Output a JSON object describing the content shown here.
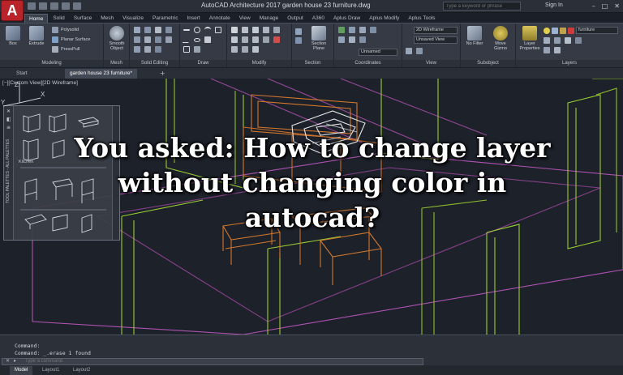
{
  "title_bar": {
    "app_logo": "A",
    "window_title": "AutoCAD Architecture 2017    garden house 23 furniture.dwg",
    "search_placeholder": "Type a keyword or phrase",
    "sign_in": "Sign In"
  },
  "ribbon_tabs": [
    "Home",
    "Solid",
    "Surface",
    "Mesh",
    "Visualize",
    "Parametric",
    "Insert",
    "Annotate",
    "View",
    "Manage",
    "Output",
    "A360",
    "Aplus Draw",
    "Aplus Modify",
    "Aplus Tools"
  ],
  "ribbon": {
    "modeling": {
      "label": "Modeling",
      "box": "Box",
      "extrude": "Extrude",
      "polysolid": "Polysolid",
      "planar_surface": "Planar Surface",
      "presspull": "PressPull"
    },
    "mesh": {
      "label": "Mesh",
      "smooth_object": "Smooth Object"
    },
    "solid_editing": {
      "label": "Solid Editing"
    },
    "draw": {
      "label": "Draw"
    },
    "modify": {
      "label": "Modify"
    },
    "section": {
      "label": "Section",
      "section_plane": "Section Plane"
    },
    "coordinates": {
      "label": "Coordinates",
      "unnamed": "Unnamed"
    },
    "view": {
      "label": "View",
      "visual_style": "2D Wireframe",
      "saved_view": "Unsaved View"
    },
    "subobject": {
      "label": "Subobject",
      "no_filter": "No Filter",
      "move_gizmo": "Move Gizmo"
    },
    "layers": {
      "label": "Layers",
      "layer_properties": "Layer Properties",
      "current_layer": "furniture"
    }
  },
  "file_tabs": {
    "start": "Start",
    "drawing": "garden house 23 furniture*",
    "add": "+"
  },
  "viewport": {
    "label": "[−][Custom View][2D Wireframe]",
    "palette_strip": "TOOL PALETTES - ALL PALETTES",
    "palette_section_1": "Kitchen",
    "ucs_x": "X",
    "ucs_y": "Y",
    "ucs_z": "Z"
  },
  "command_line": {
    "history": [
      "Command:",
      "Command: _.erase 1 found"
    ],
    "placeholder": "Type a command"
  },
  "layout_tabs": [
    "Model",
    "Layout1",
    "Layout2"
  ],
  "headline": "You asked: How to change layer without changing color in autocad?",
  "colors": {
    "viewport_bg": "#1d212a",
    "ribbon_bg": "#353a44",
    "green_lines": "#9acd32",
    "magenta_lines": "#d25fd2",
    "orange_furniture": "#d2782d",
    "white_object": "#e6e6e6"
  }
}
